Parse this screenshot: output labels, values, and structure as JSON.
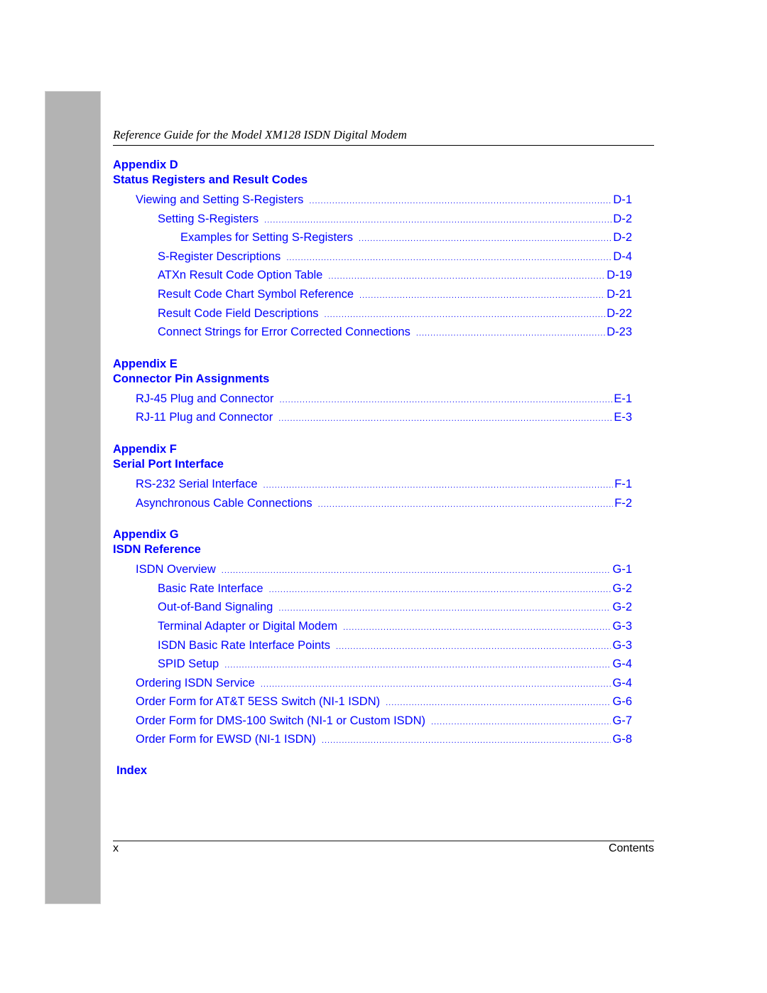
{
  "header": {
    "running_title": "Reference Guide for the Model XM128 ISDN Digital Modem"
  },
  "colors": {
    "link": "#0000ff",
    "sidebar": "#b3b3b3"
  },
  "toc": {
    "sections": [
      {
        "appendix": "Appendix D",
        "title": "Status Registers and Result Codes",
        "entries": [
          {
            "level": 1,
            "label": "Viewing and Setting S-Registers",
            "page": "D-1"
          },
          {
            "level": 2,
            "label": "Setting S-Registers",
            "page": "D-2"
          },
          {
            "level": 3,
            "label": "Examples for Setting S-Registers",
            "page": "D-2"
          },
          {
            "level": 2,
            "label": "S-Register Descriptions",
            "page": "D-4"
          },
          {
            "level": 2,
            "label": "ATXn Result Code Option Table",
            "page": "D-19"
          },
          {
            "level": 2,
            "label": "Result Code Chart Symbol Reference",
            "page": "D-21"
          },
          {
            "level": 2,
            "label": "Result Code Field Descriptions",
            "page": "D-22"
          },
          {
            "level": 2,
            "label": "Connect Strings for Error Corrected Connections",
            "page": "D-23"
          }
        ]
      },
      {
        "appendix": "Appendix E",
        "title": "Connector Pin Assignments",
        "entries": [
          {
            "level": 1,
            "label": "RJ-45 Plug and Connector",
            "page": "E-1"
          },
          {
            "level": 1,
            "label": "RJ-11 Plug and Connector",
            "page": "E-3"
          }
        ]
      },
      {
        "appendix": "Appendix F",
        "title": "Serial Port Interface",
        "entries": [
          {
            "level": 1,
            "label": "RS-232 Serial Interface",
            "page": "F-1"
          },
          {
            "level": 1,
            "label": "Asynchronous Cable Connections",
            "page": "F-2"
          }
        ]
      },
      {
        "appendix": "Appendix G",
        "title": "ISDN Reference",
        "entries": [
          {
            "level": 1,
            "label": "ISDN Overview",
            "page": "G-1"
          },
          {
            "level": 2,
            "label": "Basic Rate Interface",
            "page": "G-2"
          },
          {
            "level": 2,
            "label": "Out-of-Band Signaling",
            "page": "G-2"
          },
          {
            "level": 2,
            "label": "Terminal Adapter or Digital Modem",
            "page": "G-3"
          },
          {
            "level": 2,
            "label": "ISDN Basic Rate Interface Points",
            "page": "G-3"
          },
          {
            "level": 2,
            "label": "SPID Setup",
            "page": "G-4"
          },
          {
            "level": 1,
            "label": "Ordering ISDN Service",
            "page": "G-4"
          },
          {
            "level": 1,
            "label": "Order Form for AT&T 5ESS Switch (NI-1 ISDN)",
            "page": "G-6"
          },
          {
            "level": 1,
            "label": "Order Form for DMS-100 Switch (NI-1 or Custom ISDN)",
            "page": "G-7"
          },
          {
            "level": 1,
            "label": "Order Form for EWSD (NI-1 ISDN)",
            "page": "G-8"
          }
        ]
      }
    ],
    "index_label": "Index"
  },
  "footer": {
    "page_number": "x",
    "section_name": "Contents"
  }
}
